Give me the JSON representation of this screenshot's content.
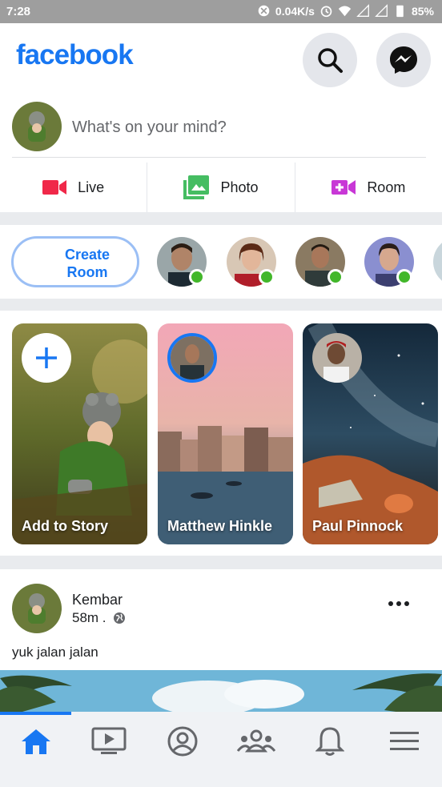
{
  "status_bar": {
    "time": "7:28",
    "network_speed": "0.04K/s",
    "battery": "85%"
  },
  "header": {
    "logo": "facebook",
    "search_icon": "search-icon",
    "messenger_icon": "messenger-icon"
  },
  "composer": {
    "placeholder": "What's on your mind?",
    "actions": [
      {
        "label": "Live",
        "icon": "video-camera-icon",
        "color": "#f02849"
      },
      {
        "label": "Photo",
        "icon": "photo-icon",
        "color": "#45bd62"
      },
      {
        "label": "Room",
        "icon": "video-plus-icon",
        "color": "#c837d6"
      }
    ]
  },
  "rooms": {
    "create_label_line1": "Create",
    "create_label_line2": "Room"
  },
  "stories": [
    {
      "name": "Add to Story"
    },
    {
      "name": "Matthew Hinkle"
    },
    {
      "name": "Paul Pinnock"
    }
  ],
  "post": {
    "author": "Kembar",
    "time": "58m .",
    "text": "yuk jalan jalan"
  },
  "tabs": [
    "home-icon",
    "video-icon",
    "profile-icon",
    "groups-icon",
    "notifications-icon",
    "menu-icon"
  ],
  "colors": {
    "brand": "#1877f2",
    "online": "#42b72a"
  }
}
